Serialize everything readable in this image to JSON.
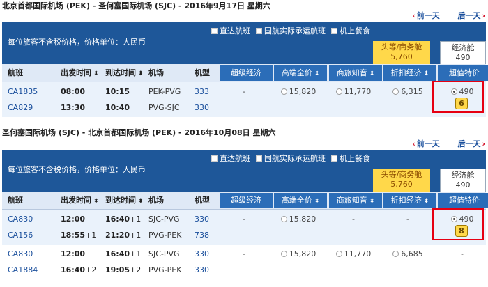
{
  "outbound": {
    "title": "北京首都国际机场 (PEK) - 圣何塞国际机场 (SJC) - 2016年9月17日 星期六",
    "prev_day": "前一天",
    "next_day": "后一天",
    "note": "每位旅客不含税价格，价格单位：人民币",
    "filters": [
      "直达航班",
      "国航实际承运航班",
      "机上餐食"
    ],
    "first_class": {
      "label": "头等/商务舱",
      "price": "5,760"
    },
    "economy": {
      "label": "经济舱",
      "price": "490"
    },
    "columns": {
      "flight": "航班",
      "depart": "出发时间",
      "arrive": "到达时间",
      "airport": "机场",
      "aircraft": "机型"
    },
    "fare_types": [
      "超级经济",
      "高端全价",
      "商旅知音",
      "折扣经济",
      "超值特价"
    ],
    "groups": [
      {
        "flights": [
          {
            "no": "CA1835",
            "depart": "08:00",
            "depart_plus": "",
            "arrive": "10:15",
            "arrive_plus": "",
            "route": "PEK-PVG",
            "aircraft": "333"
          },
          {
            "no": "CA829",
            "depart": "13:30",
            "depart_plus": "",
            "arrive": "10:40",
            "arrive_plus": "",
            "route": "PVG-SJC",
            "aircraft": "330"
          }
        ],
        "fares": [
          "-",
          "15,820",
          "11,770",
          "6,315",
          "490"
        ],
        "selected_fare": 4,
        "seats_left": "6"
      }
    ]
  },
  "inbound": {
    "title": "圣何塞国际机场 (SJC) - 北京首都国际机场 (PEK) - 2016年10月08日 星期六",
    "prev_day": "前一天",
    "next_day": "后一天",
    "note": "每位旅客不含税价格，价格单位：人民币",
    "filters": [
      "直达航班",
      "国航实际承运航班",
      "机上餐食"
    ],
    "first_class": {
      "label": "头等/商务舱",
      "price": "5,760"
    },
    "economy": {
      "label": "经济舱",
      "price": "490"
    },
    "columns": {
      "flight": "航班",
      "depart": "出发时间",
      "arrive": "到达时间",
      "airport": "机场",
      "aircraft": "机型"
    },
    "fare_types": [
      "超级经济",
      "高端全价",
      "商旅知音",
      "折扣经济",
      "超值特价"
    ],
    "groups": [
      {
        "flights": [
          {
            "no": "CA830",
            "depart": "12:00",
            "depart_plus": "",
            "arrive": "16:40",
            "arrive_plus": "+1",
            "route": "SJC-PVG",
            "aircraft": "330"
          },
          {
            "no": "CA156",
            "depart": "18:55",
            "depart_plus": "+1",
            "arrive": "21:20",
            "arrive_plus": "+1",
            "route": "PVG-PEK",
            "aircraft": "738"
          }
        ],
        "fares": [
          "-",
          "15,820",
          "-",
          "-",
          "490"
        ],
        "selected_fare": 4,
        "seats_left": "8"
      },
      {
        "flights": [
          {
            "no": "CA830",
            "depart": "12:00",
            "depart_plus": "",
            "arrive": "16:40",
            "arrive_plus": "+1",
            "route": "SJC-PVG",
            "aircraft": "330"
          },
          {
            "no": "CA1884",
            "depart": "16:40",
            "depart_plus": "+2",
            "arrive": "19:05",
            "arrive_plus": "+2",
            "route": "PVG-PEK",
            "aircraft": "330"
          }
        ],
        "fares": [
          "-",
          "15,820",
          "11,770",
          "6,685",
          "-"
        ],
        "selected_fare": -1,
        "seats_left": ""
      }
    ]
  },
  "colors": {
    "bar": "#1e5799",
    "header": "#dfe9f6",
    "first_class": "#ffd84a",
    "flight_link": "#1a4f9c",
    "highlight": "#e60012"
  }
}
